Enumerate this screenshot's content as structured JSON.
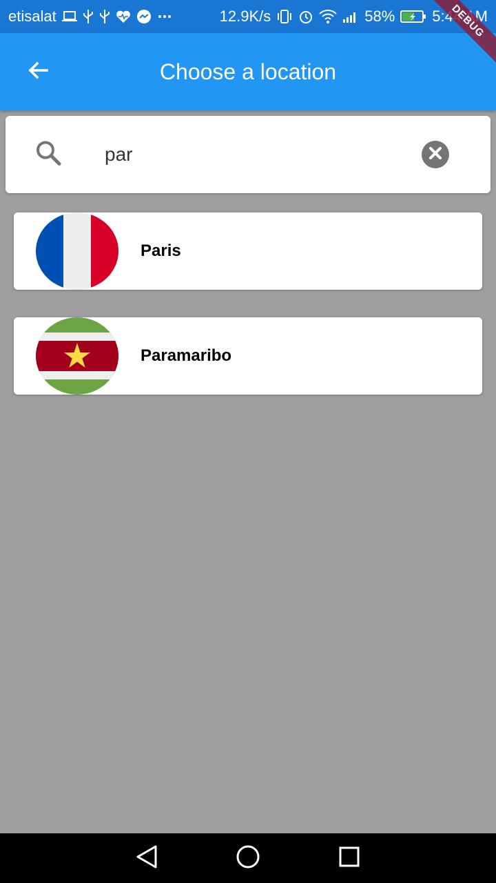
{
  "status_bar": {
    "carrier": "etisalat",
    "network_speed": "12.9K/s",
    "battery": "58%",
    "time": "5:44 AM",
    "color": "#1976d2"
  },
  "debug_banner": "DEBUG",
  "app_bar": {
    "title": "Choose a location",
    "back_icon": "arrow-left-icon",
    "color": "#2196f3"
  },
  "search": {
    "value": "par",
    "search_icon": "search-icon",
    "clear_icon": "clear-icon"
  },
  "locations": [
    {
      "name": "Paris",
      "flag": "france-flag"
    },
    {
      "name": "Paramaribo",
      "flag": "suriname-flag"
    }
  ],
  "nav_bar": {
    "back": "nav-back-icon",
    "home": "nav-home-icon",
    "recents": "nav-recents-icon"
  }
}
